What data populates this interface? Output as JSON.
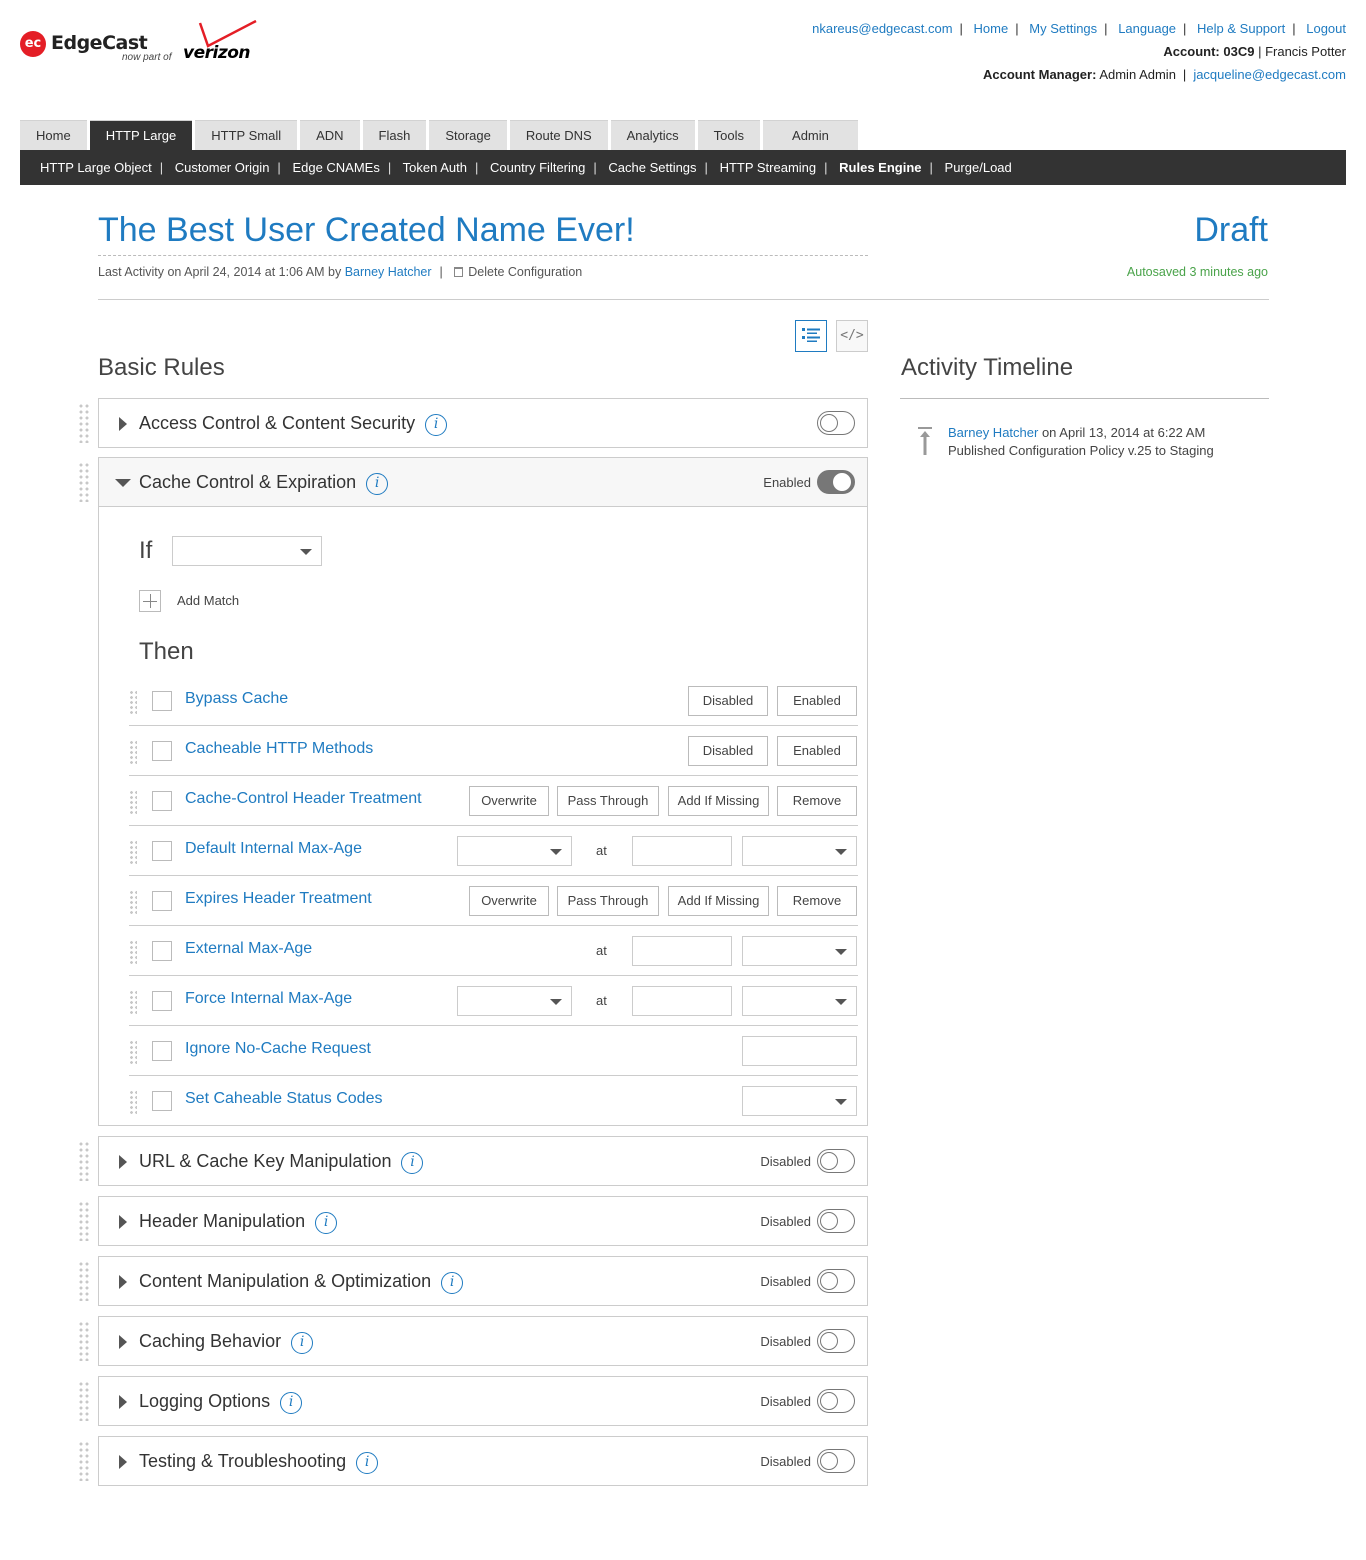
{
  "logo": {
    "ec_badge": "ec",
    "brand": "EdgeCast",
    "sub": "now part of",
    "partner": "verizon"
  },
  "colors": {
    "link": "#1f7bc1",
    "dark_nav": "#333333",
    "autosave": "#4aa34a",
    "brand_red": "#e41e26"
  },
  "top_links": [
    "nkareus@edgecast.com",
    "Home",
    "My Settings",
    "Language",
    "Help & Support",
    "Logout"
  ],
  "account": {
    "label": "Account:",
    "id": "03C9",
    "name": "Francis Potter"
  },
  "manager": {
    "label": "Account Manager:",
    "name": "Admin Admin",
    "email": "jacqueline@edgecast.com"
  },
  "tabs": [
    "Home",
    "HTTP Large",
    "HTTP Small",
    "ADN",
    "Flash",
    "Storage",
    "Route DNS",
    "Analytics",
    "Tools",
    "Admin"
  ],
  "active_tab": "HTTP Large",
  "subnav": [
    "HTTP Large Object",
    "Customer Origin",
    "Edge CNAMEs",
    "Token Auth",
    "Country Filtering",
    "Cache Settings",
    "HTTP Streaming",
    "Rules Engine",
    "Purge/Load"
  ],
  "active_subnav": "Rules Engine",
  "config": {
    "title": "The Best User Created Name Ever!",
    "status": "Draft",
    "meta_prefix": "Last Activity on April 24, 2014 at 1:06 AM by",
    "meta_user": "Barney Hatcher",
    "delete_label": "Delete Configuration",
    "autosave": "Autosaved 3 minutes ago"
  },
  "view_icons": [
    "list-view-icon",
    "code-view-icon"
  ],
  "basic_rules_heading": "Basic Rules",
  "timeline": {
    "heading": "Activity Timeline",
    "user": "Barney Hatcher",
    "when": "on April 13, 2014 at 6:22 AM",
    "action": "Published Configuration Policy v.25 to Staging"
  },
  "panels": {
    "access": {
      "title": "Access Control & Content Security",
      "state": ""
    },
    "cache": {
      "title": "Cache Control & Expiration",
      "state": "Enabled"
    },
    "url": {
      "title": "URL & Cache Key Manipulation",
      "state": "Disabled"
    },
    "header": {
      "title": "Header Manipulation",
      "state": "Disabled"
    },
    "content": {
      "title": "Content Manipulation & Optimization",
      "state": "Disabled"
    },
    "caching": {
      "title": "Caching Behavior",
      "state": "Disabled"
    },
    "logging": {
      "title": "Logging Options",
      "state": "Disabled"
    },
    "testing": {
      "title": "Testing & Troubleshooting",
      "state": "Disabled"
    }
  },
  "cache_body": {
    "if_label": "If",
    "add_match": "Add Match",
    "then_label": "Then",
    "at": "at",
    "buttons": {
      "disabled": "Disabled",
      "enabled": "Enabled",
      "overwrite": "Overwrite",
      "pass_through": "Pass Through",
      "add_if_missing": "Add If Missing",
      "remove": "Remove"
    },
    "rows": [
      "Bypass Cache",
      "Cacheable HTTP Methods",
      "Cache-Control Header Treatment",
      "Default Internal Max-Age",
      "Expires Header Treatment",
      "External Max-Age",
      "Force Internal Max-Age",
      "Ignore No-Cache Request",
      "Set Caheable Status Codes"
    ]
  }
}
